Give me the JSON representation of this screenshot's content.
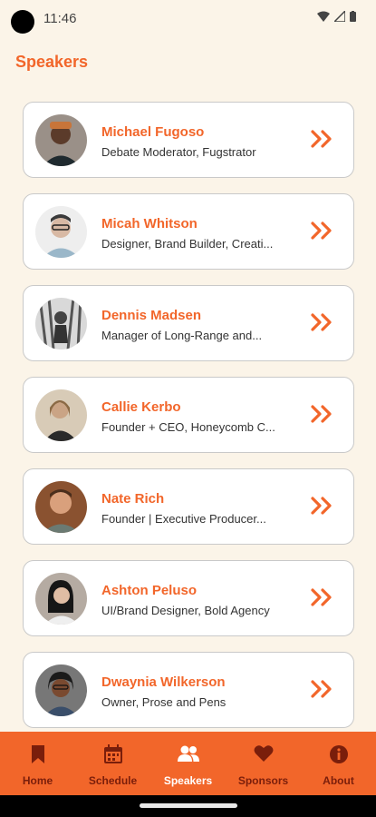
{
  "status_bar": {
    "time": "11:46"
  },
  "header": {
    "title": "Speakers"
  },
  "speakers": [
    {
      "name": "Michael Fugoso",
      "role": "Debate Moderator, Fugstrator"
    },
    {
      "name": "Micah Whitson",
      "role": "Designer, Brand Builder, Creati..."
    },
    {
      "name": "Dennis Madsen",
      "role": "Manager of Long-Range and..."
    },
    {
      "name": "Callie Kerbo",
      "role": "Founder + CEO, Honeycomb C..."
    },
    {
      "name": "Nate Rich",
      "role": "Founder | Executive Producer..."
    },
    {
      "name": "Ashton Peluso",
      "role": "UI/Brand Designer, Bold Agency"
    },
    {
      "name": "Dwaynia Wilkerson",
      "role": "Owner, Prose and Pens"
    }
  ],
  "nav": {
    "items": [
      {
        "label": "Home",
        "icon": "bookmark-icon"
      },
      {
        "label": "Schedule",
        "icon": "calendar-icon"
      },
      {
        "label": "Speakers",
        "icon": "people-icon",
        "active": true
      },
      {
        "label": "Sponsors",
        "icon": "heart-icon"
      },
      {
        "label": "About",
        "icon": "info-icon"
      }
    ]
  },
  "colors": {
    "accent": "#f2662a",
    "background": "#fbf4e8",
    "nav_inactive": "#7a1e0b",
    "nav_active": "#ffffff"
  }
}
